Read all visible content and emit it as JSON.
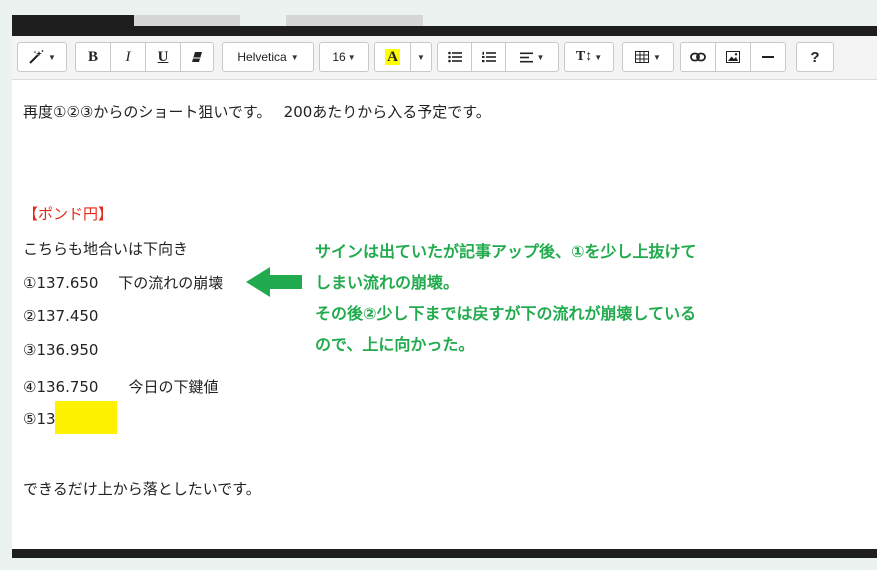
{
  "toolbar": {
    "magic_label": "✨",
    "bold_label": "B",
    "italic_label": "I",
    "underline_label": "U",
    "font_name": "Helvetica",
    "font_size": "16",
    "highlight_label": "A",
    "highlight_color": "#ffff00",
    "text_size_label": "T↕",
    "help_label": "?",
    "icons": [
      "magic-wand-icon",
      "eraser-icon",
      "bullet-list-icon",
      "numbered-list-icon",
      "align-icon",
      "table-icon",
      "link-icon",
      "image-icon",
      "horizontal-rule-icon"
    ]
  },
  "editor": {
    "line1": "再度①②③からのショート狙いです。　 200あたりから入る予定です。",
    "heading": "【ポンド円】",
    "trend": "こちらも地合いは下向き",
    "level1": "①137.650　 下の流れの崩壊",
    "level2": "②137.450",
    "level3": "③136.950",
    "level4": "④136.750　　今日の下鍵値",
    "level5": "⑤13",
    "closing": "できるだけ上から落としたいです。"
  },
  "annotation": {
    "line1": "サインは出ていたが記事アップ後、①を少し上抜けて",
    "line2": "しまい流れの崩壊。",
    "line3": "その後②少し下までは戻すが下の流れが崩壊している",
    "line4": "ので、上に向かった。",
    "color": "#22ab4e"
  },
  "colors": {
    "heading_red": "#e8281c",
    "redaction_yellow": "#fff200",
    "frame_dark": "#1e1e1e"
  }
}
